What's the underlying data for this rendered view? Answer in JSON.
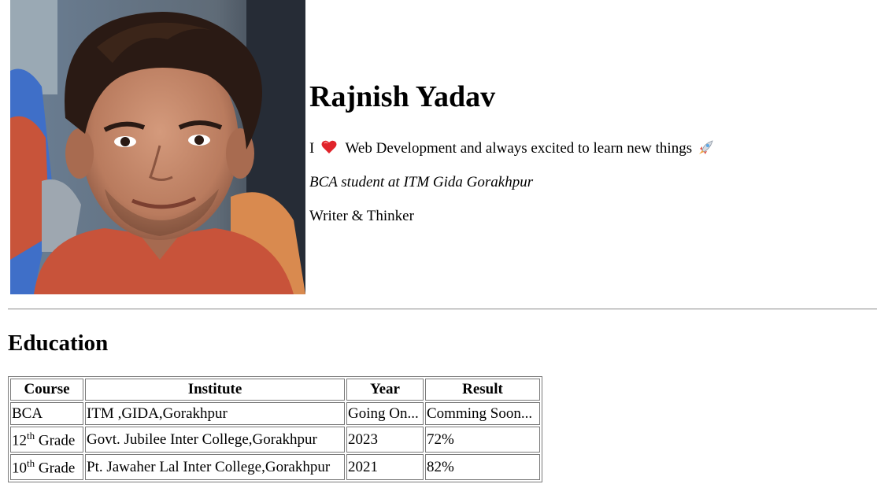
{
  "profile": {
    "name": "Rajnish Yadav",
    "tagline_prefix": "I",
    "tagline_text": "Web Development and always excited to learn new things",
    "subtitle": "BCA student at ITM Gida Gorakhpur",
    "role": "Writer & Thinker",
    "photo_icon": "profile-photo",
    "heart_icon": "heart-icon",
    "rocket_icon": "rocket-icon"
  },
  "education": {
    "title": "Education",
    "headers": {
      "course": "Course",
      "institute": "Institute",
      "year": "Year",
      "result": "Result"
    },
    "rows": [
      {
        "course": "BCA",
        "course_sup": "",
        "course_suffix": "",
        "institute": "ITM ,GIDA,Gorakhpur",
        "year": "Going On...",
        "result": "Comming Soon..."
      },
      {
        "course": "12",
        "course_sup": "th",
        "course_suffix": " Grade",
        "institute": "Govt. Jubilee Inter College,Gorakhpur",
        "year": "2023",
        "result": "72%"
      },
      {
        "course": "10",
        "course_sup": "th",
        "course_suffix": " Grade",
        "institute": "Pt. Jawaher Lal Inter College,Gorakhpur",
        "year": "2021",
        "result": "82%"
      }
    ]
  },
  "colors": {
    "text": "#000000",
    "divider": "#9a9a9a",
    "heart": "#e0242b",
    "background": "#ffffff"
  }
}
